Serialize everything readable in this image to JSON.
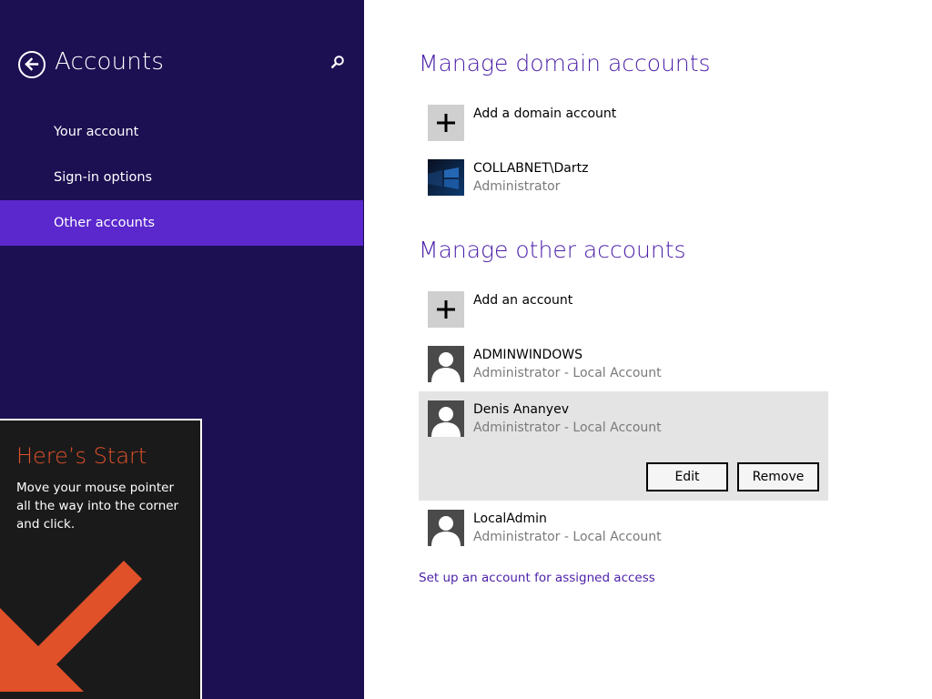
{
  "colors": {
    "left_pane_bg": "#1c0f52",
    "nav_selected_bg": "#5a28cc",
    "heading_purple": "#4b1fa8",
    "start_orange": "#e0512a",
    "card_bg": "#e4e4e4"
  },
  "left_pane": {
    "back_icon": "back-arrow-icon",
    "title": "Accounts",
    "search_icon": "search-icon",
    "nav_items": [
      {
        "label": "Your account"
      },
      {
        "label": "Sign-in options"
      },
      {
        "label": "Other accounts",
        "selected": true
      }
    ]
  },
  "domain_section": {
    "heading": "Manage domain accounts",
    "add_label": "Add a domain account",
    "accounts": [
      {
        "name": "COLLABNET\\Dartz",
        "role": "Administrator"
      }
    ]
  },
  "other_section": {
    "heading": "Manage other accounts",
    "add_label": "Add an account",
    "accounts": [
      {
        "name": "ADMINWINDOWS",
        "role": "Administrator - Local Account"
      },
      {
        "name": "Denis Ananyev",
        "role": "Administrator - Local Account",
        "selected": true
      },
      {
        "name": "LocalAdmin",
        "role": "Administrator - Local Account"
      }
    ],
    "edit_label": "Edit",
    "remove_label": "Remove"
  },
  "assigned_access_link": "Set up an account for assigned access",
  "start_tip": {
    "title": "Here’s Start",
    "body": "Move your mouse pointer all the way into the corner and click."
  }
}
